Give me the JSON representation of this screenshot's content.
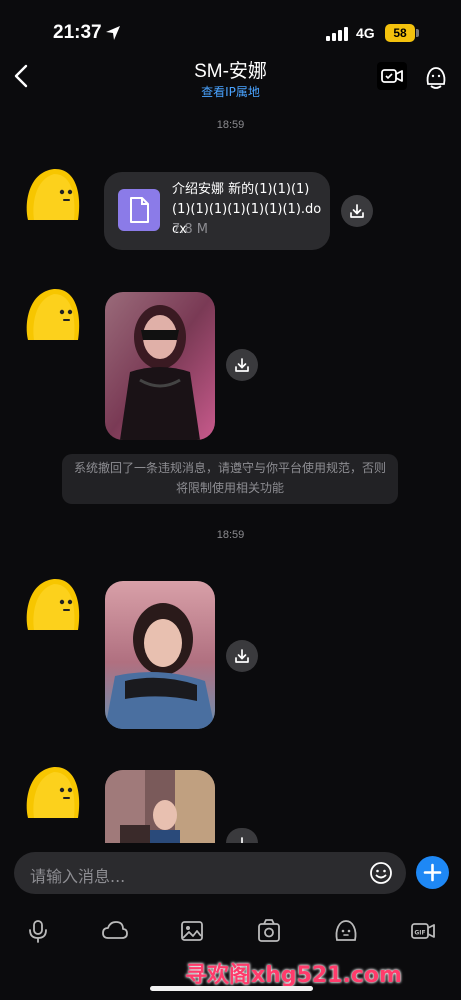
{
  "status": {
    "time": "21:37",
    "network": "4G",
    "battery": "58"
  },
  "header": {
    "title": "SM-安娜",
    "subtitle": "查看IP属地"
  },
  "messages": {
    "timestamp1": "18:59",
    "file": {
      "name": "介绍安娜 新的(1)(1)(1)(1)(1)(1)(1)(1)(1)(1).docx",
      "size": "7.8 M"
    },
    "system_notice": "系统撤回了一条违规消息，请遵守与你平台使用规范，否则将限制使用相关功能",
    "timestamp2": "18:59"
  },
  "input": {
    "placeholder": "请输入消息..."
  },
  "toolbar": [
    "mic-icon",
    "cloud-icon",
    "image-icon",
    "camera-icon",
    "sticker-icon",
    "gif-icon"
  ],
  "watermark": "寻欢阁xhg521.com",
  "colors": {
    "accent": "#1e88f5",
    "link": "#4aa3ff",
    "bubble": "#2b2b2e",
    "avatar": "#f7c600",
    "battery": "#f4c20d"
  }
}
